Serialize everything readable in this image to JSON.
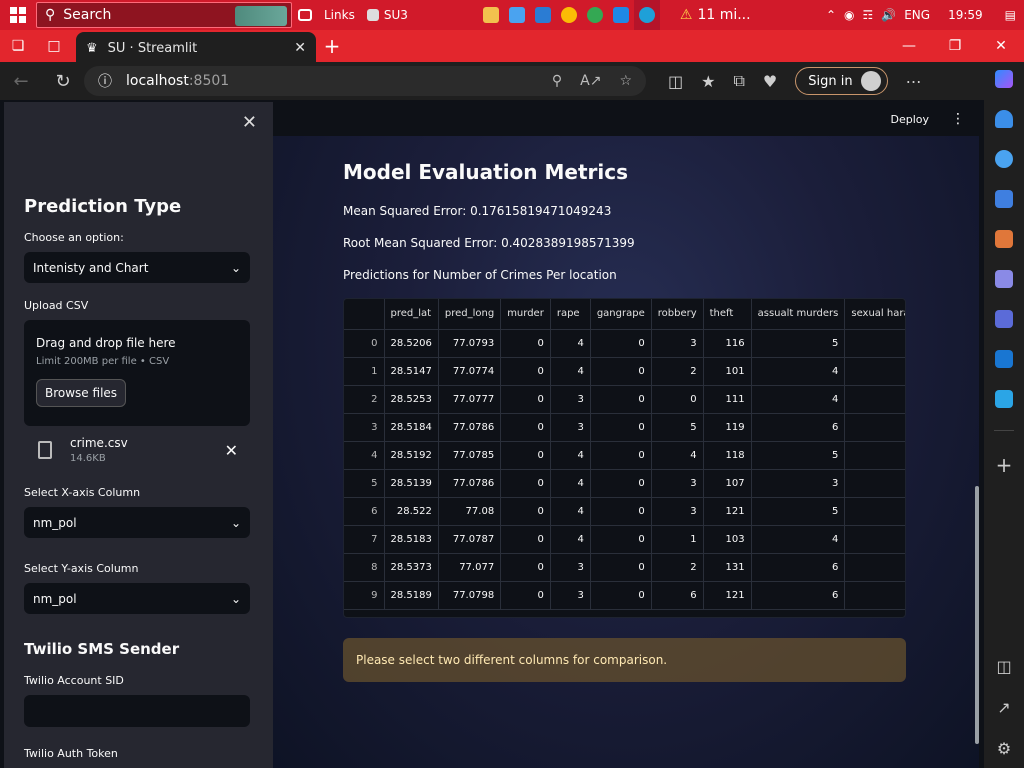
{
  "taskbar": {
    "search_placeholder": "Search",
    "links_label": "Links",
    "su3_label": "SU3",
    "weather": "11 mi...",
    "language": "ENG",
    "time": "19:59"
  },
  "browser": {
    "tab_title": "SU · Streamlit",
    "url_host": "localhost",
    "url_port": ":8501",
    "signin_label": "Sign in"
  },
  "sidebar": {
    "prediction_heading": "Prediction Type",
    "choose_label": "Choose an option:",
    "choose_value": "Intenisty and Chart",
    "upload_label": "Upload CSV",
    "drop_text": "Drag and drop file here",
    "limit_text": "Limit 200MB per file • CSV",
    "browse_label": "Browse files",
    "file_name": "crime.csv",
    "file_size": "14.6KB",
    "x_label": "Select X-axis Column",
    "x_value": "nm_pol",
    "y_label": "Select Y-axis Column",
    "y_value": "nm_pol",
    "twilio_heading": "Twilio SMS Sender",
    "sid_label": "Twilio Account SID",
    "token_label": "Twilio Auth Token"
  },
  "header": {
    "deploy_label": "Deploy"
  },
  "main": {
    "title": "Model Evaluation Metrics",
    "mse": "Mean Squared Error: 0.17615819471049243",
    "rmse": "Root Mean Squared Error: 0.4028389198571399",
    "predictions_label": "Predictions for Number of Crimes Per location",
    "warning": "Please select two different columns for comparison."
  },
  "table": {
    "columns": [
      "",
      "pred_lat",
      "pred_long",
      "murder",
      "rape",
      "gangrape",
      "robbery",
      "theft",
      "assualt murders",
      "sexual harassem"
    ],
    "rows": [
      [
        "0",
        "28.5206",
        "77.0793",
        "0",
        "4",
        "0",
        "3",
        "116",
        "5",
        ""
      ],
      [
        "1",
        "28.5147",
        "77.0774",
        "0",
        "4",
        "0",
        "2",
        "101",
        "4",
        ""
      ],
      [
        "2",
        "28.5253",
        "77.0777",
        "0",
        "3",
        "0",
        "0",
        "111",
        "4",
        ""
      ],
      [
        "3",
        "28.5184",
        "77.0786",
        "0",
        "3",
        "0",
        "5",
        "119",
        "6",
        ""
      ],
      [
        "4",
        "28.5192",
        "77.0785",
        "0",
        "4",
        "0",
        "4",
        "118",
        "5",
        ""
      ],
      [
        "5",
        "28.5139",
        "77.0786",
        "0",
        "4",
        "0",
        "3",
        "107",
        "3",
        ""
      ],
      [
        "6",
        "28.522",
        "77.08",
        "0",
        "4",
        "0",
        "3",
        "121",
        "5",
        ""
      ],
      [
        "7",
        "28.5183",
        "77.0787",
        "0",
        "4",
        "0",
        "1",
        "103",
        "4",
        ""
      ],
      [
        "8",
        "28.5373",
        "77.077",
        "0",
        "3",
        "0",
        "2",
        "131",
        "6",
        ""
      ],
      [
        "9",
        "28.5189",
        "77.0798",
        "0",
        "3",
        "0",
        "6",
        "121",
        "6",
        ""
      ]
    ]
  }
}
